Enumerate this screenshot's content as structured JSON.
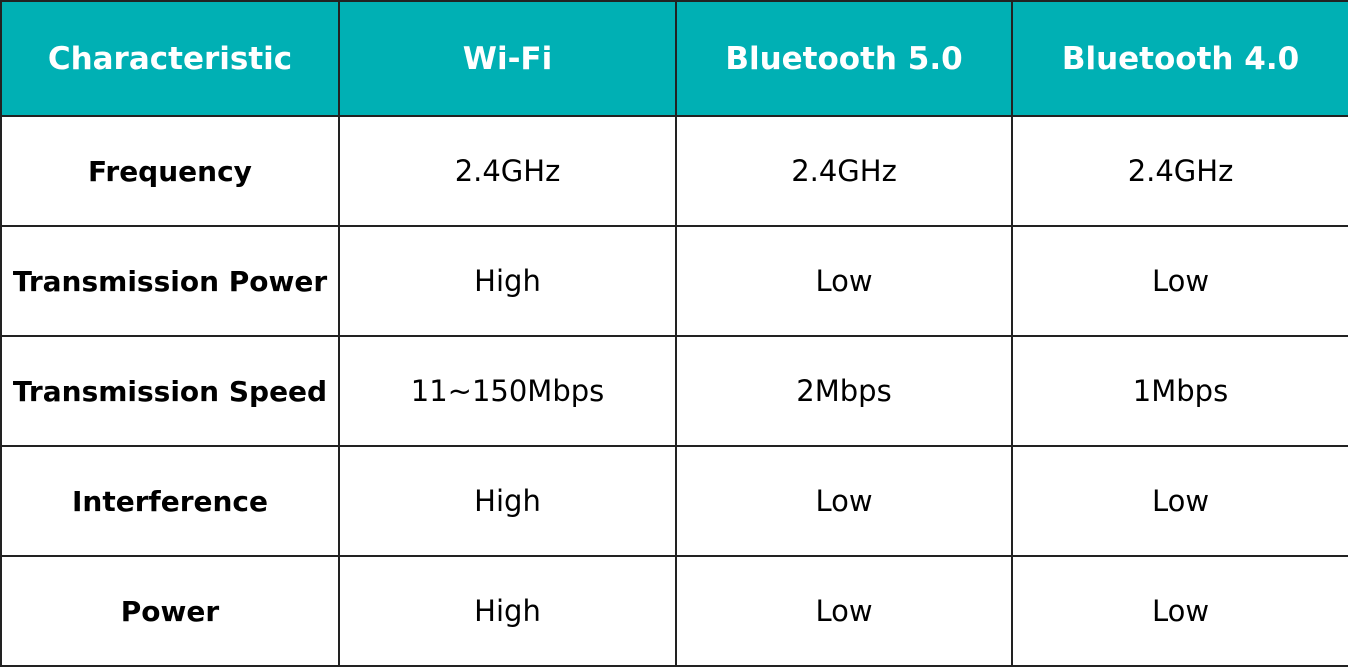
{
  "colors": {
    "header_bg": "#00B0B4",
    "header_text": "#FFFFFF",
    "border": "#222222"
  },
  "headers": [
    "Characteristic",
    "Wi-Fi",
    "Bluetooth 5.0",
    "Bluetooth 4.0"
  ],
  "rows": [
    {
      "label": "Frequency",
      "values": [
        "2.4GHz",
        "2.4GHz",
        "2.4GHz"
      ]
    },
    {
      "label": "Transmission Power",
      "values": [
        "High",
        "Low",
        "Low"
      ]
    },
    {
      "label": "Transmission Speed",
      "values": [
        "11~150Mbps",
        "2Mbps",
        "1Mbps"
      ]
    },
    {
      "label": "Interference",
      "values": [
        "High",
        "Low",
        "Low"
      ]
    },
    {
      "label": "Power",
      "values": [
        "High",
        "Low",
        "Low"
      ]
    }
  ]
}
